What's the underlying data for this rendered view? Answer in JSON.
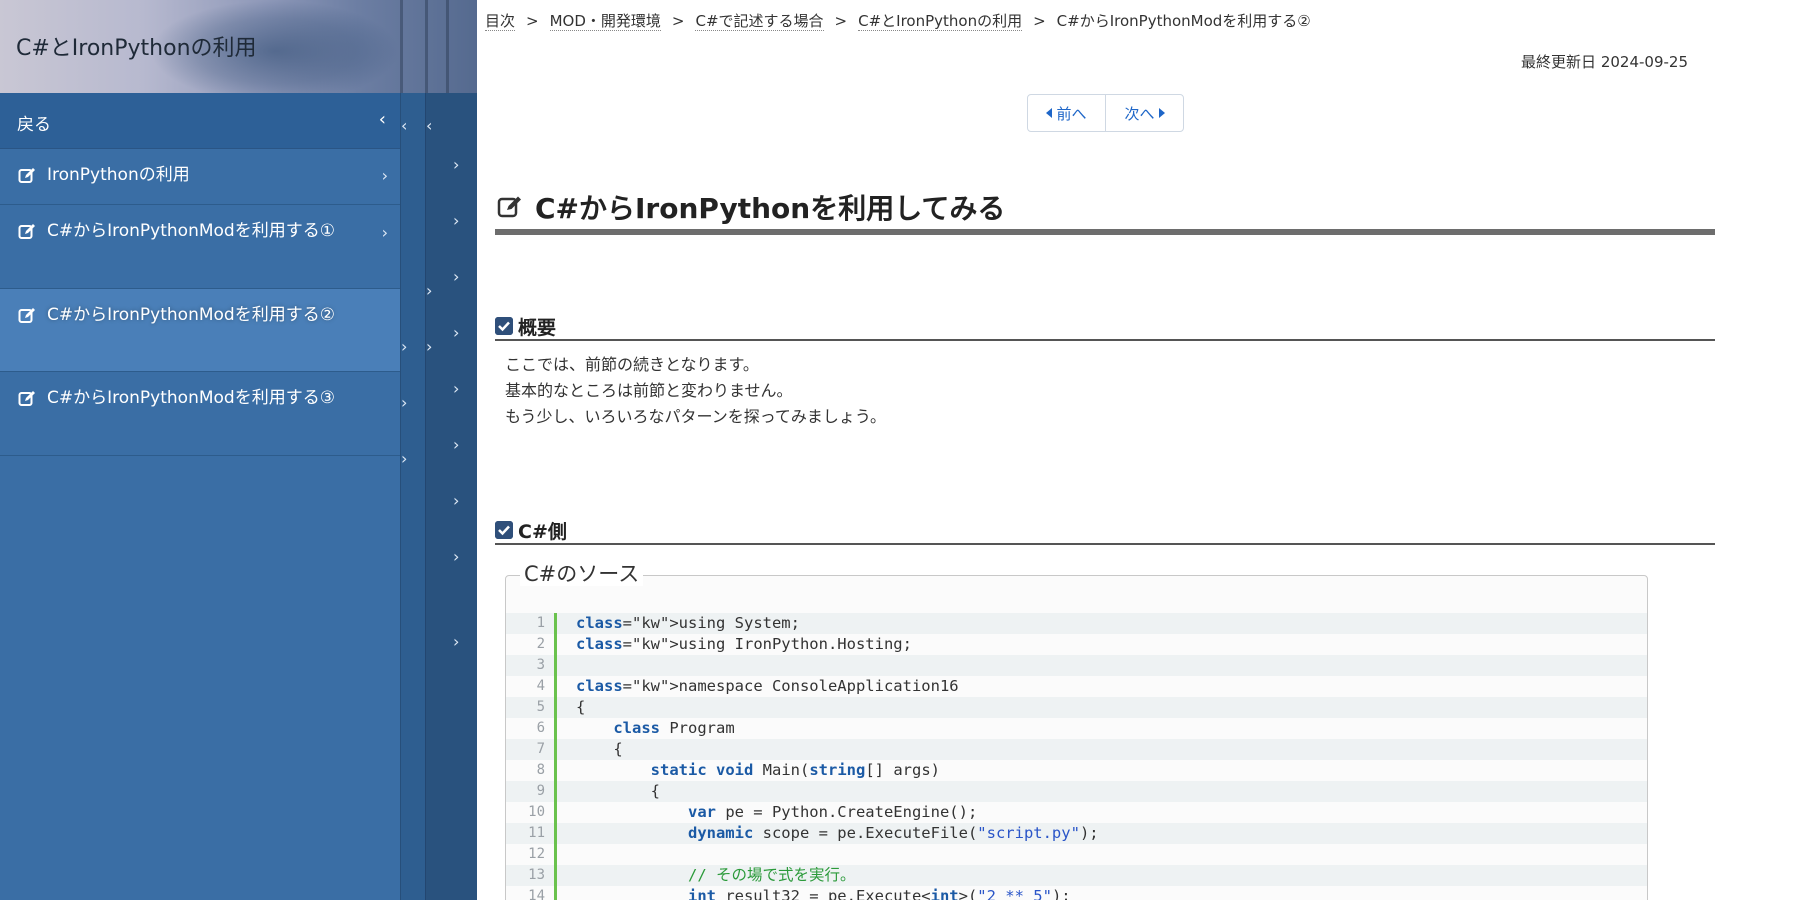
{
  "sidebar": {
    "title": "C#とIronPythonの利用",
    "back_label": "戻る",
    "chevron_left": "‹",
    "chevron_right": "›",
    "items": [
      {
        "label": "IronPythonの利用",
        "active": false
      },
      {
        "label": "C#からIronPythonModを利用する①",
        "active": false
      },
      {
        "label": "C#からIronPythonModを利用する②",
        "active": true
      },
      {
        "label": "C#からIronPythonModを利用する③",
        "active": false
      }
    ]
  },
  "breadcrumb": {
    "items": [
      "目次",
      "MOD・開発環境",
      "C#で記述する場合",
      "C#とIronPythonの利用"
    ],
    "separator": ">",
    "current": "C#からIronPythonModを利用する②"
  },
  "last_updated": "最終更新日 2024-09-25",
  "pager": {
    "prev_label": "前へ",
    "next_label": "次へ"
  },
  "page_title": "C#からIronPythonを利用してみる",
  "sections": {
    "overview": {
      "title": "概要",
      "lines": [
        "ここでは、前節の続きとなります。",
        "基本的なところは前節と変わりません。",
        "もう少し、いろいろなパターンを探ってみましょう。"
      ]
    },
    "csharp": {
      "title": "C#側",
      "source_legend": "C#のソース",
      "code_lines": [
        "using System;",
        "using IronPython.Hosting;",
        "",
        "namespace ConsoleApplication16",
        "{",
        "    class Program",
        "    {",
        "        static void Main(string[] args)",
        "        {",
        "            var pe = Python.CreateEngine();",
        "            dynamic scope = pe.ExecuteFile(\"script.py\");",
        "",
        "            // その場で式を実行。",
        "            int result32 = pe.Execute<int>(\"2 ** 5\");"
      ]
    }
  },
  "colors": {
    "sidebar_bg": "#3a6ea5",
    "sidebar_active": "#4a7fb8",
    "link": "#1e66c8",
    "keyword": "#1b5aa5",
    "string": "#2a55c8",
    "comment": "#2b9a3a",
    "gutter": "#6ac24d"
  },
  "icons": {
    "nav_item": "edit-icon",
    "section": "check-square-icon",
    "pager_prev": "caret-left-icon",
    "pager_next": "caret-right-icon"
  }
}
